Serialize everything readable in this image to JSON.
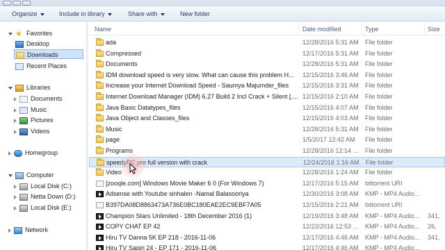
{
  "toolbar": {
    "organize": "Organize",
    "include_in_library": "Include in library",
    "share_with": "Share with",
    "new_folder": "New folder"
  },
  "nav": {
    "favorites": "Favorites",
    "desktop": "Desktop",
    "downloads": "Downloads",
    "recent_places": "Recent Places",
    "libraries": "Libraries",
    "documents": "Documents",
    "music": "Music",
    "pictures": "Pictures",
    "videos": "Videos",
    "homegroup": "Homegroup",
    "computer": "Computer",
    "local_disk_c": "Local Disk (C:)",
    "netta_down_d": "Netta Down (D:)",
    "local_disk_e": "Local Disk (E:)",
    "network": "Network"
  },
  "columns": {
    "name": "Name",
    "date_modified": "Date modified",
    "type": "Type",
    "size": "Size"
  },
  "files": [
    {
      "name": "ada",
      "date": "12/28/2016 5:31 AM",
      "type": "File folder",
      "size": "",
      "icon": "folder"
    },
    {
      "name": "Compressed",
      "date": "12/17/2016 5:31 AM",
      "type": "File folder",
      "size": "",
      "icon": "folder"
    },
    {
      "name": "Documents",
      "date": "12/28/2016 5:31 AM",
      "type": "File folder",
      "size": "",
      "icon": "folder"
    },
    {
      "name": "IDM download speed is very slow. What can cause this problem  H...",
      "date": "12/15/2016 3:46 AM",
      "type": "File folder",
      "size": "",
      "icon": "folder"
    },
    {
      "name": "Increase your Internet Download Speed - Saumya Majumder_files",
      "date": "12/15/2016 3:31 AM",
      "type": "File folder",
      "size": "",
      "icon": "folder"
    },
    {
      "name": "Internet Download Manager (IDM) 6.27 Build 2 Incl Crack + Silent [....",
      "date": "12/15/2016 2:10 AM",
      "type": "File folder",
      "size": "",
      "icon": "folder"
    },
    {
      "name": "Java Basic Datatypes_files",
      "date": "12/15/2016 4:07 AM",
      "type": "File folder",
      "size": "",
      "icon": "folder"
    },
    {
      "name": "Java Object and Classes_files",
      "date": "12/15/2016 4:03 AM",
      "type": "File folder",
      "size": "",
      "icon": "folder"
    },
    {
      "name": "Music",
      "date": "12/28/2016 5:31 AM",
      "type": "File folder",
      "size": "",
      "icon": "folder"
    },
    {
      "name": "page",
      "date": "1/5/2017 12:42 AM",
      "type": "File folder",
      "size": "",
      "icon": "folder"
    },
    {
      "name": "Programs",
      "date": "12/28/2016 12:14 ...",
      "type": "File folder",
      "size": "",
      "icon": "folder"
    },
    {
      "name": "speedyPC  pro full version with crack",
      "date": "12/24/2016 1:16 AM",
      "type": "File folder",
      "size": "",
      "icon": "folder",
      "highlighted": true
    },
    {
      "name": "Video",
      "date": "12/28/2016 1:24 AM",
      "type": "File folder",
      "size": "",
      "icon": "folder"
    },
    {
      "name": "[zooqle.com] Windows Movie Maker 6 0 (For Windows 7)",
      "date": "12/17/2016 5:15 AM",
      "type": "bittorrent URI",
      "size": "",
      "icon": "torrent"
    },
    {
      "name": "Adsense with Youtube sinhalen -Namal Balasooriya",
      "date": "12/30/2016 3:08 AM",
      "type": "KMP - MP4 Audio...",
      "size": "",
      "icon": "media"
    },
    {
      "name": "B397DA08D8863473A736E0BC180EAE2EC9EBF7A05",
      "date": "12/15/2016 2:21 AM",
      "type": "bittorrent URI",
      "size": "",
      "icon": "torrent"
    },
    {
      "name": "Champion Stars Unlimited - 18th December 2016 (1)",
      "date": "12/19/2016 3:48 AM",
      "type": "KMP - MP4 Audio...",
      "size": "341,",
      "icon": "media"
    },
    {
      "name": "COPY CHAT EP 42",
      "date": "12/22/2016 12:53 ...",
      "type": "KMP - MP4 Audio...",
      "size": "26,",
      "icon": "media"
    },
    {
      "name": "Hiru TV Danna 5K EP 218 - 2016-11-06",
      "date": "12/17/2016 4:46 AM",
      "type": "KMP - MP4 Audio...",
      "size": "341,",
      "icon": "media"
    },
    {
      "name": "Hiru TV Sapiri 24 - EP 171 - 2016-11-06",
      "date": "12/17/2016 4:46 AM",
      "type": "KMP - MP4 Audio...",
      "size": "",
      "icon": "media"
    }
  ]
}
